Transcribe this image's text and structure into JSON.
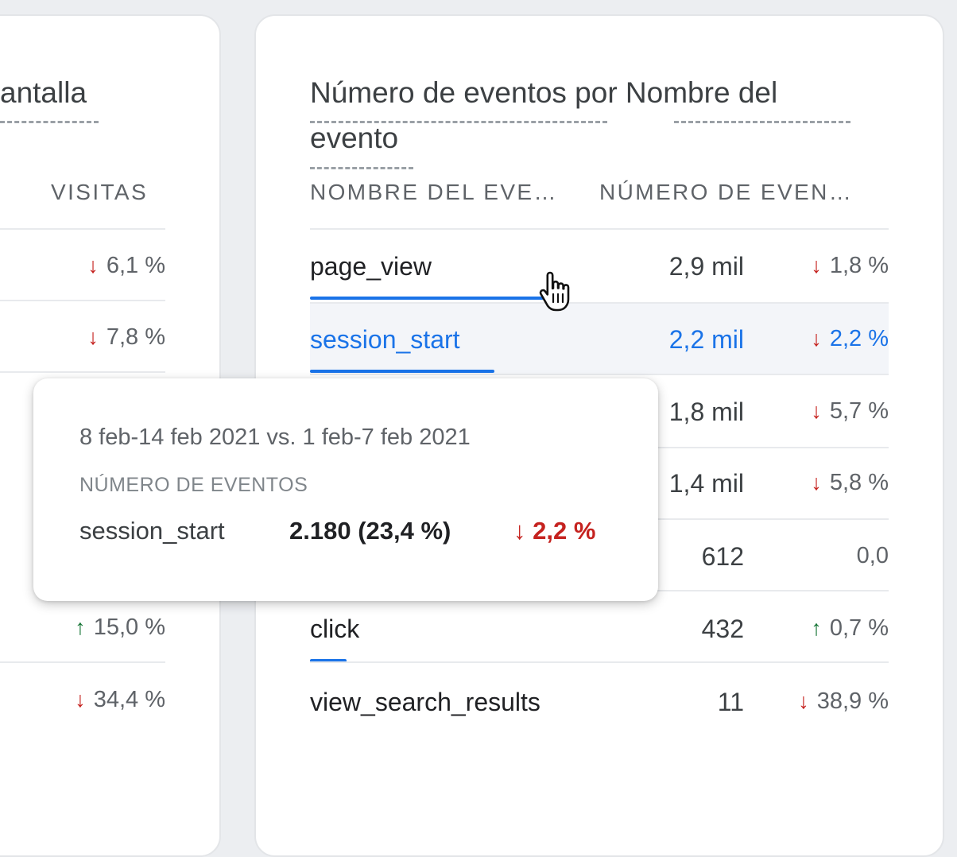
{
  "left_card": {
    "title_partial": "antalla",
    "column_header": "VISITAS",
    "rows": [
      {
        "direction": "down",
        "change": "6,1 %"
      },
      {
        "direction": "down",
        "change": "7,8 %"
      },
      {
        "direction": "up",
        "change": "15,0 %"
      },
      {
        "direction": "down",
        "change": "34,4 %"
      }
    ]
  },
  "right_card": {
    "title_line1": "Número de eventos por Nombre del",
    "title_line2": "evento",
    "column_name": "NOMBRE DEL EVE…",
    "column_count": "NÚMERO DE EVEN…",
    "rows": [
      {
        "name": "page_view",
        "value": "2,9 mil",
        "direction": "down",
        "change": "1,8 %",
        "share": 0.31
      },
      {
        "name": "session_start",
        "value": "2,2 mil",
        "direction": "down",
        "change": "2,2 %",
        "share": 0.234,
        "highlighted": true
      },
      {
        "name": "",
        "value": "1,8 mil",
        "direction": "down",
        "change": "5,7 %"
      },
      {
        "name": "",
        "value": "1,4 mil",
        "direction": "down",
        "change": "5,8 %"
      },
      {
        "name": "",
        "value": "612",
        "direction": "none",
        "change": "0,0"
      },
      {
        "name": "click",
        "value": "432",
        "direction": "up",
        "change": "0,7 %",
        "share": 0.046
      },
      {
        "name": "view_search_results",
        "value": "11",
        "direction": "down",
        "change": "38,9 %"
      }
    ]
  },
  "tooltip": {
    "date_range": "8 feb-14 feb 2021 vs. 1 feb-7 feb 2021",
    "metric": "NÚMERO DE EVENTOS",
    "event": "session_start",
    "value": "2.180 (23,4 %)",
    "arrow": "↓",
    "change": "2,2 %"
  },
  "icons": {
    "down_arrow": "↓",
    "up_arrow": "↑",
    "cursor": "hand-pointer-icon"
  },
  "colors": {
    "accent": "#1a73e8",
    "negative": "#c5221f",
    "positive": "#137333"
  }
}
